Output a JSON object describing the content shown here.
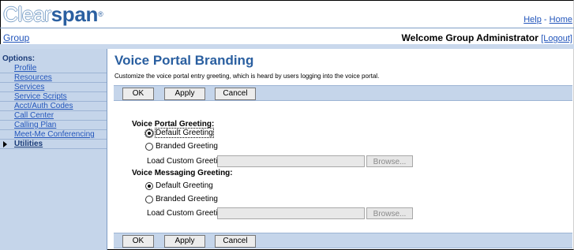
{
  "brand": {
    "logo_pre": "Clear",
    "logo_post": "span",
    "logo_mark": "®"
  },
  "top_links": {
    "help": "Help",
    "separator": "-",
    "home": "Home"
  },
  "header": {
    "group_link": "Group",
    "welcome": "Welcome Group Administrator",
    "logout": "[Logout]"
  },
  "sidebar": {
    "heading": "Options:",
    "items": [
      {
        "label": "Profile",
        "active": false
      },
      {
        "label": "Resources",
        "active": false
      },
      {
        "label": "Services",
        "active": false
      },
      {
        "label": "Service Scripts",
        "active": false
      },
      {
        "label": "Acct/Auth Codes",
        "active": false
      },
      {
        "label": "Call Center",
        "active": false
      },
      {
        "label": "Calling Plan",
        "active": false
      },
      {
        "label": "Meet-Me Conferencing",
        "active": false
      },
      {
        "label": "Utilities",
        "active": true
      }
    ]
  },
  "page": {
    "title": "Voice Portal Branding",
    "description": "Customize the voice portal entry greeting, which is heard by users logging into the voice portal."
  },
  "buttons": {
    "ok": "OK",
    "apply": "Apply",
    "cancel": "Cancel"
  },
  "voice_portal": {
    "heading": "Voice Portal Greeting:",
    "default_label": "Default Greeting",
    "branded_label": "Branded Greeting",
    "selected": "default",
    "load_label": "Load Custom Greeting:",
    "file_value": "",
    "browse_label": "Browse..."
  },
  "voice_messaging": {
    "heading": "Voice Messaging Greeting:",
    "default_label": "Default Greeting",
    "branded_label": "Branded Greeting",
    "selected": "default",
    "load_label": "Load Custom Greeting:",
    "file_value": "",
    "browse_label": "Browse..."
  },
  "colors": {
    "brand_blue": "#2a5fa0",
    "link_blue": "#2255bb",
    "sidebar_bg": "#c5d5ea"
  }
}
